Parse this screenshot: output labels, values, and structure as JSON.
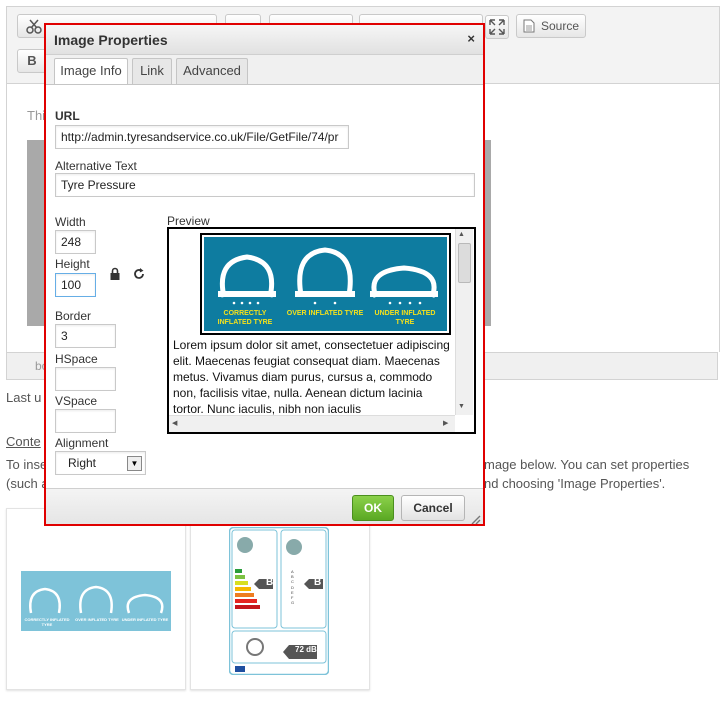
{
  "editor": {
    "toolbar": {
      "source_label": "Source",
      "bold_label": "B"
    },
    "content_partial_text": "Thi",
    "status_text": "body",
    "last_updated_partial": "Last u",
    "content_link_partial": "Conte",
    "help_left_line1": "To inse",
    "help_left_line2": "(such a",
    "help_right_line1": "mage below. You can set properties",
    "help_right_line2": "nd choosing 'Image Properties'."
  },
  "thumbnail_tyre": {
    "labels": [
      "CORRECTLY INFLATED TYRE",
      "OVER INFLATED TYRE",
      "UNDER INFLATED TYRE"
    ]
  },
  "thumbnail_label": {
    "letters": [
      "A",
      "B",
      "C",
      "D",
      "E",
      "F",
      "G"
    ],
    "grade_fuel": "B",
    "grade_wet": "B",
    "noise": "72 dB"
  },
  "dialog": {
    "title": "Image Properties",
    "close_symbol": "×",
    "tabs": [
      {
        "label": "Image Info",
        "active": true
      },
      {
        "label": "Link",
        "active": false
      },
      {
        "label": "Advanced",
        "active": false
      }
    ],
    "url_label": "URL",
    "url_value": "http://admin.tyresandservice.co.uk/File/GetFile/74/pr",
    "alt_label": "Alternative Text",
    "alt_value": "Tyre Pressure",
    "width_label": "Width",
    "width_value": "248",
    "height_label": "Height",
    "height_value": "100",
    "border_label": "Border",
    "border_value": "3",
    "hspace_label": "HSpace",
    "hspace_value": "",
    "vspace_label": "VSpace",
    "vspace_value": "",
    "alignment_label": "Alignment",
    "alignment_value": "Right",
    "preview_label": "Preview",
    "preview_text": "Lorem ipsum dolor sit amet, consectetuer adipiscing elit. Maecenas feugiat consequat diam. Maecenas metus. Vivamus diam purus, cursus a, commodo non, facilisis vitae, nulla. Aenean dictum lacinia tortor. Nunc iaculis, nibh non iaculis",
    "ok_label": "OK",
    "cancel_label": "Cancel"
  },
  "colors": {
    "highlight_border": "#e00000",
    "ok_green": "#5aa823",
    "tyre_blue": "#0e7ca0",
    "tyre_label_yellow": "#f5e11b"
  }
}
